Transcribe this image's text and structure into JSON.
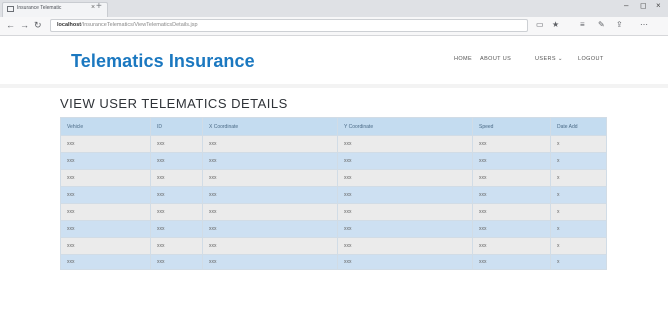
{
  "browser": {
    "tab_title": "Insurance Telematic",
    "tab_close": "×",
    "new_tab": "+",
    "win_min": "–",
    "win_max": "◻",
    "win_close": "×",
    "back": "←",
    "forward": "→",
    "reload": "↻",
    "address_host": "localhost",
    "address_path": "/InsuranceTelematics/ViewTelematicsDetails.jsp",
    "icons": [
      "reading-view-icon",
      "favorite-star-icon",
      "hub-icon",
      "notes-icon",
      "share-icon",
      "more-icon"
    ]
  },
  "site": {
    "brand": "Telematics Insurance",
    "menu": {
      "home": "HOME",
      "about": "ABOUT US",
      "users": "USERS ⌄",
      "logout": "LOGOUT"
    }
  },
  "main": {
    "heading": "VIEW USER TELEMATICS DETAILS",
    "table": {
      "headers": [
        "Vehicle",
        "ID",
        "X Coordinate",
        "Y Coordinate",
        "Speed",
        "Date Add"
      ],
      "rows": [
        [
          "xxx",
          "xxx",
          "xxx",
          "xxx",
          "xxx",
          "x"
        ],
        [
          "xxx",
          "xxx",
          "xxx",
          "xxx",
          "xxx",
          "x"
        ],
        [
          "xxx",
          "xxx",
          "xxx",
          "xxx",
          "xxx",
          "x"
        ],
        [
          "xxx",
          "xxx",
          "xxx",
          "xxx",
          "xxx",
          "x"
        ],
        [
          "xxx",
          "xxx",
          "xxx",
          "xxx",
          "xxx",
          "x"
        ],
        [
          "xxx",
          "xxx",
          "xxx",
          "xxx",
          "xxx",
          "x"
        ],
        [
          "xxx",
          "xxx",
          "xxx",
          "xxx",
          "xxx",
          "x"
        ],
        [
          "xxx",
          "xxx",
          "xxx",
          "xxx",
          "xxx",
          "x"
        ]
      ]
    }
  },
  "colors": {
    "brand": "#1b78c0",
    "header_row": "#c4dcf0",
    "row_gray": "#ebebeb",
    "row_blue": "#cde0f2"
  }
}
